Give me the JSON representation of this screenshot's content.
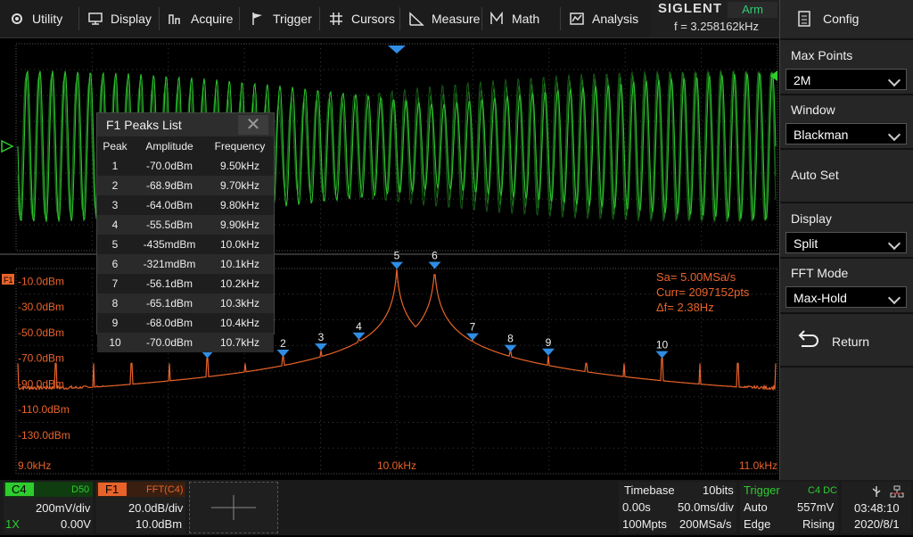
{
  "menu": {
    "utility": "Utility",
    "display": "Display",
    "acquire": "Acquire",
    "trigger": "Trigger",
    "cursors": "Cursors",
    "measure": "Measure",
    "math": "Math",
    "analysis": "Analysis"
  },
  "brand": {
    "logo": "SIGLENT",
    "state": "Arm",
    "freq": "f = 3.258162kHz"
  },
  "panel": {
    "title": "Config",
    "max_points_label": "Max Points",
    "max_points_value": "2M",
    "window_label": "Window",
    "window_value": "Blackman",
    "auto_set_label": "Auto Set",
    "display_label": "Display",
    "display_value": "Split",
    "fft_mode_label": "FFT Mode",
    "fft_mode_value": "Max-Hold",
    "return_label": "Return"
  },
  "peaks_list": {
    "title": "F1 Peaks List",
    "headers": [
      "Peak",
      "Amplitude",
      "Frequency"
    ],
    "rows": [
      [
        "1",
        "-70.0dBm",
        "9.50kHz"
      ],
      [
        "2",
        "-68.9dBm",
        "9.70kHz"
      ],
      [
        "3",
        "-64.0dBm",
        "9.80kHz"
      ],
      [
        "4",
        "-55.5dBm",
        "9.90kHz"
      ],
      [
        "5",
        "-435mdBm",
        "10.0kHz"
      ],
      [
        "6",
        "-321mdBm",
        "10.1kHz"
      ],
      [
        "7",
        "-56.1dBm",
        "10.2kHz"
      ],
      [
        "8",
        "-65.1dBm",
        "10.3kHz"
      ],
      [
        "9",
        "-68.0dBm",
        "10.4kHz"
      ],
      [
        "10",
        "-70.0dBm",
        "10.7kHz"
      ]
    ]
  },
  "fft": {
    "sa": "Sa=  5.00MSa/s",
    "curr": "Curr= 2097152pts",
    "df": "Δf=  2.38Hz",
    "y_labels": [
      "-10.0dBm",
      "-30.0dBm",
      "-50.0dBm",
      "-70.0dBm",
      "-90.0dBm",
      "-110.0dBm",
      "-130.0dBm"
    ],
    "x_labels": [
      "9.0kHz",
      "10.0kHz",
      "11.0kHz"
    ]
  },
  "chart_data": {
    "type": "line",
    "x_unit": "kHz",
    "y_unit": "dBm",
    "xlim": [
      9.0,
      11.0
    ],
    "y_ticks": [
      -10,
      -30,
      -50,
      -70,
      -90,
      -110,
      -130
    ],
    "peaks": [
      {
        "label": "1",
        "x": 9.5,
        "y": -70.0
      },
      {
        "label": "2",
        "x": 9.7,
        "y": -68.9
      },
      {
        "label": "3",
        "x": 9.8,
        "y": -64.0
      },
      {
        "label": "4",
        "x": 9.9,
        "y": -55.5
      },
      {
        "label": "5",
        "x": 10.0,
        "y": -0.435
      },
      {
        "label": "6",
        "x": 10.1,
        "y": -0.321
      },
      {
        "label": "7",
        "x": 10.2,
        "y": -56.1
      },
      {
        "label": "8",
        "x": 10.3,
        "y": -65.1
      },
      {
        "label": "9",
        "x": 10.4,
        "y": -68.0
      },
      {
        "label": "10",
        "x": 10.7,
        "y": -70.0
      }
    ]
  },
  "channel": {
    "name": "C4",
    "coupling": "D50",
    "scale": "200mV/div",
    "probe": "1X",
    "offset": "0.00V"
  },
  "math": {
    "name": "F1",
    "source": "FFT(C4)",
    "scale": "20.0dB/div",
    "ref": "10.0dBm"
  },
  "timebase": {
    "label": "Timebase",
    "bits": "10bits",
    "delay": "0.00s",
    "scale": "50.0ms/div",
    "points": "100Mpts",
    "rate": "200MSa/s"
  },
  "trigger": {
    "label": "Trigger",
    "source": "C4 DC",
    "mode": "Auto",
    "level": "557mV",
    "type": "Edge",
    "slope": "Rising"
  },
  "clock": {
    "time": "03:48:10",
    "date": "2020/8/1"
  },
  "colors": {
    "ch4": "#2ecc2e",
    "fft": "#e8632a",
    "marker": "#2f8de4"
  }
}
